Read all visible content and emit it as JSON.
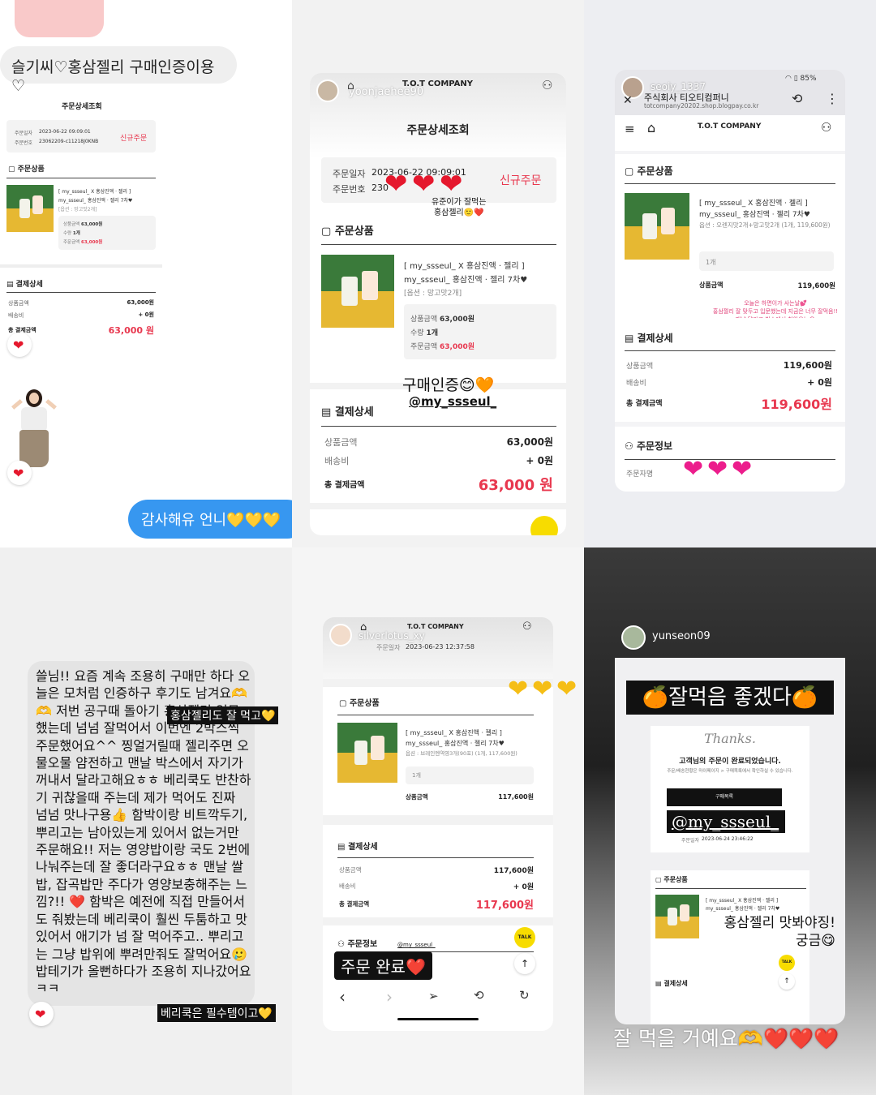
{
  "p1": {
    "bubble": "슬기씨♡홍삼젤리 구매인증이용♡",
    "page_title": "주문상세조회",
    "order_date_label": "주문일자",
    "order_date": "2023-06-22 09:09:01",
    "order_no_label": "주문번호",
    "order_no": "23062209-c11218J0KNB",
    "status": "신규주문",
    "products_title": "주문상품",
    "product_line1": "[ my_ssseul_ X 홍삼진액 · 젤리 ]",
    "product_line2": "my_ssseul_ 홍삼진액 · 젤리 7차♥",
    "option": "[옵션 : 망고맛2개]",
    "price_label": "상품금액",
    "price": "63,000원",
    "qty_label": "수량",
    "qty": "1개",
    "order_amount_label": "주문금액",
    "order_amount": "63,000원",
    "payment_title": "결제상세",
    "pay_price_label": "상품금액",
    "pay_price": "63,000원",
    "ship_label": "배송비",
    "ship": "+ 0원",
    "total_label": "총 결제금액",
    "total": "63,000 원",
    "reply": "감사해유 언니💛💛💛"
  },
  "p2": {
    "brand": "T.O.T COMPANY",
    "username": "yoonjaehee90",
    "page_title": "주문상세조회",
    "order_date_label": "주문일자",
    "order_date": "2023-06-22 09:09:01",
    "order_no_label": "주문번호",
    "order_no_partial": "230",
    "status": "신규주문",
    "sticker_note": "유준이가 잘먹는\n홍삼젤리🙂❤️",
    "products_title": "주문상품",
    "product_line1": "[ my_ssseul_ X 홍삼진액 · 젤리 ]",
    "product_line2": "my_ssseul_ 홍삼진액 · 젤리 7차♥",
    "option": "[옵션 : 망고맛2개]",
    "price_label": "상품금액",
    "price": "63,000원",
    "qty_label": "수량",
    "qty": "1개",
    "order_amount_label": "주문금액",
    "order_amount": "63,000원",
    "cert_sticker": "구매인증😊🧡",
    "mention": "@my_ssseul_",
    "payment_title": "결제상세",
    "pay_price_label": "상품금액",
    "pay_price": "63,000원",
    "ship_label": "배송비",
    "ship": "+ 0원",
    "total_label": "총 결제금액",
    "total": "63,000 원"
  },
  "p3": {
    "username": "seoiy_1337",
    "company": "주식회사 티오티컴퍼니",
    "url": "totcompany20202.shop.blogpay.co.kr",
    "battery": "85%",
    "brand": "T.O.T COMPANY",
    "products_title": "주문상품",
    "product_line1": "[ my_ssseul_ X 홍삼진액 · 젤리 ]",
    "product_line2": "my_ssseul_ 홍삼진액 · 젤리 7차♥",
    "option": "옵션 : 오렌지맛2개+망고맛2개 (1개, 119,600원)",
    "qty": "1개",
    "price_label": "상품금액",
    "price": "119,600원",
    "note": "오늘은 하면이가 사는날💕\n홍삼젤리 잘 맞두고 입문했는데 지금은 너무 잘먹음!!\n맨날 달라고 박스에서 찾아오는😂\n하루에 2개만 먹는 거아니!\n베리쿡은 남아있는 거 빼고 필요한 거만 주문ㅎㅎ\n오늘도 맘고 주문하는 @my_ssseul_",
    "payment_title": "결제상세",
    "pay_price_label": "상품금액",
    "pay_price": "119,600원",
    "ship_label": "배송비",
    "ship": "+ 0원",
    "total_label": "총 결제금액",
    "total": "119,600원",
    "orderer_title": "주문정보",
    "orderer_label": "주문자명"
  },
  "p4": {
    "message": "쓸님!! 요즘 계속 조용히 구매만 하다 오늘은 모처럼 인증하구 후기도 남겨요🫶🫶 저번 공구때 돌아기 홍삼젤리 입문했는데 넘넘 잘먹어서 이번엔 2박스씩 주문했어요^^ 찡얼거릴때 젤리주면 오물오물 얌전하고 맨날 박스에서 자기가 꺼내서 달라고해요ㅎㅎ 베리쿡도 반찬하기 귀찮을때 주는데 제가 먹어도 진짜 넘넘 맛나구용👍 함박이랑 비트깍두기, 뿌리고는 남아있는게 있어서 없는거만 주문해요!! 저는 영양밥이랑 국도 2번에 나눠주는데 잘 좋더라구요ㅎㅎ 맨날 쌀밥, 잡곡밥만 주다가 영양보충해주는 느낌?!! ❤️ 함박은 예전에 직접 만들어서도 줘봤는데 베리쿡이 훨씬 두툼하고 맛있어서 애기가 넘 잘 먹어주고.. 뿌리고는 그냥 밥위에 뿌려만줘도 잘먹어요🥲 밥테기가 올뻔하다가 조용히 지나갔어요ㅋㅋ",
    "sticker1": "홍삼젤리도 잘 먹고💛",
    "sticker2": "베리쿡은 필수템이고💛"
  },
  "p5": {
    "username": "silverlotus_xy",
    "brand": "T.O.T COMPANY",
    "order_date_label": "주문일자",
    "order_date": "2023-06-23 12:37:58",
    "products_title": "주문상품",
    "product_line1": "[ my_ssseul_ X 홍삼진액 · 젤리 ]",
    "product_line2": "my_ssseul_ 홍삼진액 · 젤리 7차♥",
    "option": "옵션 : 브레인멘역영3개(90포) (1개, 117,600원)",
    "qty": "1개",
    "price_label": "상품금액",
    "price": "117,600원",
    "payment_title": "결제상세",
    "pay_price_label": "상품금액",
    "pay_price": "117,600원",
    "ship_label": "배송비",
    "ship": "+ 0원",
    "total_label": "총 결제금액",
    "total": "117,600원",
    "orderer_title": "주문정보",
    "mention": "@my_ssseul_",
    "done_sticker": "주문 완료❤️",
    "talk": "TALK"
  },
  "p6": {
    "username": "yunseon09",
    "banner": "🍊잘먹음 좋겠다🍊",
    "thanks": "Thanks.",
    "complete": "고객님의 주문이 완료되었습니다.",
    "sub": "주문/배송현황은 마이페이지 > 구매목록에서 확인하실 수 있습니다.",
    "btn": "구매목록",
    "mention": "@my_ssseul_",
    "order_date_label": "주문일자",
    "order_date": "2023-06-24 23:46:22",
    "products_title": "주문상품",
    "product_line1": "[ my_ssseul_ X 홍삼진액 · 젤리 ]",
    "product_line2": "my_ssseul_ 홍삼진액 · 젤리 7차♥",
    "curious": "홍삼젤리 맛봐야징!\n궁금😋",
    "payment_title": "결제상세",
    "talk": "TALK",
    "bottom": "잘 먹을 거예요🫶❤️❤️❤️"
  }
}
